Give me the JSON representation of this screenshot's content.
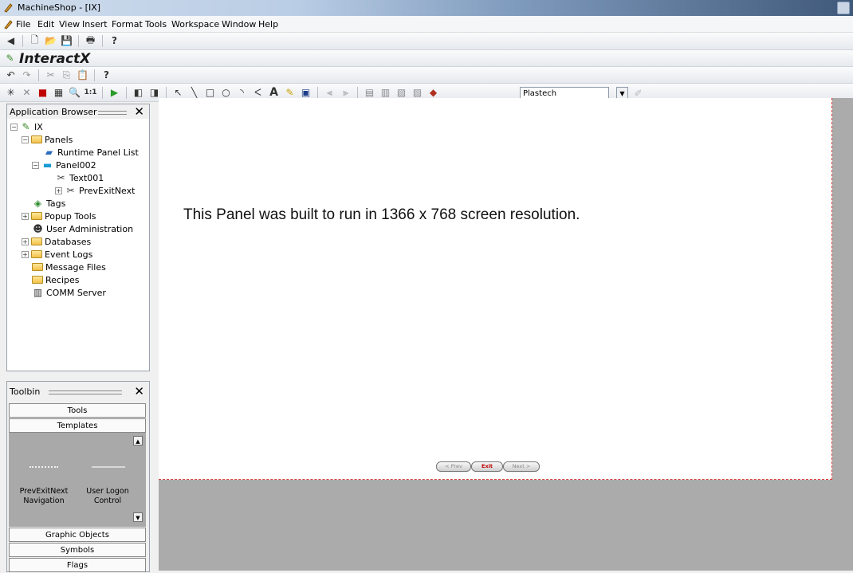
{
  "window": {
    "title": "MachineShop - [IX]"
  },
  "menu": [
    "File",
    "Edit",
    "View",
    "Insert",
    "Format",
    "Tools",
    "Workspace",
    "Window",
    "Help"
  ],
  "ixbar": {
    "title": "InteractX"
  },
  "toolbar": {
    "font_combo_value": "Plastech"
  },
  "app_browser": {
    "title": "Application Browser",
    "tree": {
      "root": "IX",
      "panels": "Panels",
      "runtime_panel_list": "Runtime Panel List",
      "panel002": "Panel002",
      "text001": "Text001",
      "prevexitnext": "PrevExitNext",
      "tags": "Tags",
      "popup_tools": "Popup Tools",
      "user_admin": "User Administration",
      "databases": "Databases",
      "event_logs": "Event Logs",
      "message_files": "Message Files",
      "recipes": "Recipes",
      "comm_server": "COMM Server"
    }
  },
  "toolbin": {
    "title": "Toolbin",
    "tools": "Tools",
    "templates": "Templates",
    "template_items": [
      {
        "line1": "PrevExitNext",
        "line2": "Navigation"
      },
      {
        "line1": "User Logon",
        "line2": "Control"
      }
    ],
    "graphic_objects": "Graphic Objects",
    "symbols": "Symbols",
    "flags": "Flags"
  },
  "canvas": {
    "message": "This Panel was built to run in 1366 x 768 screen resolution.",
    "prev": "< Prev",
    "exit": "Exit",
    "next": "Next >"
  },
  "colors": {
    "exit_text": "#c00000",
    "canvas_border": "#e04040",
    "workspace_bg": "#ababab"
  }
}
